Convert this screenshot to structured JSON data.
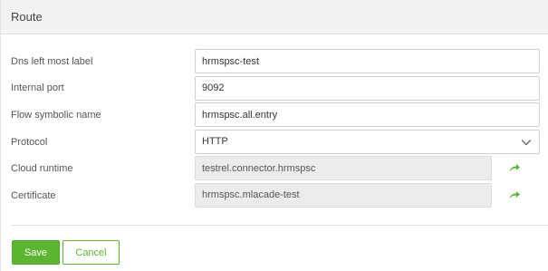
{
  "panel": {
    "title": "Route"
  },
  "form": {
    "fields": [
      {
        "label": "Dns left most label",
        "value": "hrmspsc-test"
      },
      {
        "label": "Internal port",
        "value": "9092"
      },
      {
        "label": "Flow symbolic name",
        "value": "hrmspsc.all.entry"
      },
      {
        "label": "Protocol",
        "value": "HTTP"
      },
      {
        "label": "Cloud runtime",
        "value": "testrel.connector.hrmspsc"
      },
      {
        "label": "Certificate",
        "value": "hrmspsc.mlacade-test"
      }
    ]
  },
  "actions": {
    "save_label": "Save",
    "cancel_label": "Cancel"
  },
  "colors": {
    "accent": "#5cb531",
    "header_bg": "#f3f3f3",
    "readonly_bg": "#ececec"
  },
  "icons": {
    "select": "chevron-down-icon",
    "link": "arrow-right-icon"
  }
}
